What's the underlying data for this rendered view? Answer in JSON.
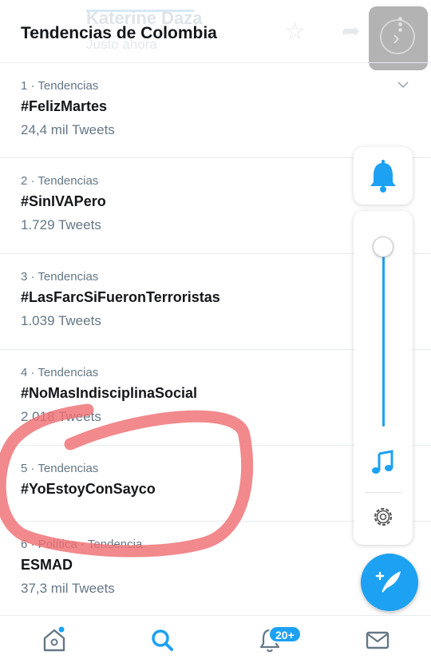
{
  "ghost_header": {
    "back_glyph": "←",
    "name": "Katerine Daza",
    "subtitle": "Justo ahora",
    "star_glyph": "☆",
    "share_glyph": "➦",
    "menu_chevron": "›"
  },
  "page": {
    "title": "Tendencias de Colombia"
  },
  "trends": [
    {
      "meta": "1 · Tendencias",
      "name": "#FelizMartes",
      "count": "24,4 mil Tweets"
    },
    {
      "meta": "2 · Tendencias",
      "name": "#SinIVAPero",
      "count": "1.729 Tweets"
    },
    {
      "meta": "3 · Tendencias",
      "name": "#LasFarcSiFueronTerroristas",
      "count": "1.039 Tweets"
    },
    {
      "meta": "4 · Tendencias",
      "name": "#NoMasIndisciplinaSocial",
      "count": "2.018 Tweets"
    },
    {
      "meta": "5 · Tendencias",
      "name": "#YoEstoyConSayco",
      "count": ""
    },
    {
      "meta": "6 · Política · Tendencia",
      "name": "ESMAD",
      "count": "37,3 mil Tweets"
    }
  ],
  "control_center": {
    "volume_level": 1.0,
    "icons": [
      "bell-icon",
      "music-note-icon",
      "gear-icon"
    ]
  },
  "tabbar": {
    "icons": [
      "home-icon",
      "search-icon",
      "notifications-icon",
      "messages-icon"
    ],
    "notifications_badge": "20+"
  },
  "colors": {
    "accent": "#1da1f2",
    "annotation": "#ef6f73",
    "secondary_text": "#657786"
  }
}
